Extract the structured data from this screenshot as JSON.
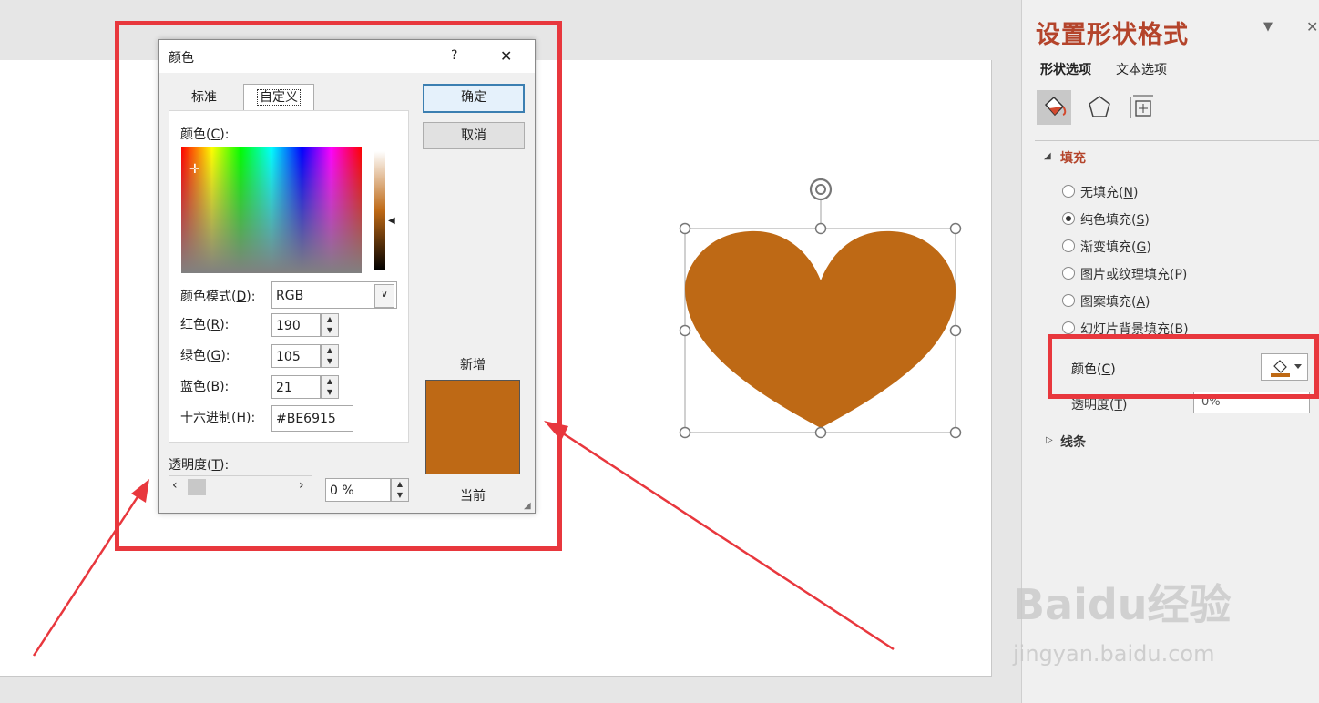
{
  "dialog": {
    "title": "颜色",
    "help": "?",
    "close": "✕",
    "tabs": [
      "标准",
      "自定义"
    ],
    "ok": "确定",
    "cancel": "取消",
    "color_label": "颜色(",
    "color_key": "C",
    "mode_label": "颜色模式(",
    "mode_key": "D",
    "mode_value": "RGB",
    "red_label": "红色(",
    "red_key": "R",
    "red_value": "190",
    "green_label": "绿色(",
    "green_key": "G",
    "green_value": "105",
    "blue_label": "蓝色(",
    "blue_key": "B",
    "blue_value": "21",
    "hex_label": "十六进制(",
    "hex_key": "H",
    "hex_value": "#BE6915",
    "transparency_label": "透明度(",
    "transparency_key": "T",
    "transparency_value": "0 %",
    "new_label": "新增",
    "current_label": "当前",
    "swatch_color": "#BE6915"
  },
  "pane": {
    "title": "设置形状格式",
    "tab_shape": "形状选项",
    "tab_text": "文本选项",
    "fill_header": "填充",
    "options": [
      {
        "label": "无填充(",
        "key": "N",
        "selected": false
      },
      {
        "label": "纯色填充(",
        "key": "S",
        "selected": true
      },
      {
        "label": "渐变填充(",
        "key": "G",
        "selected": false
      },
      {
        "label": "图片或纹理填充(",
        "key": "P",
        "selected": false
      },
      {
        "label": "图案填充(",
        "key": "A",
        "selected": false
      },
      {
        "label": "幻灯片背景填充(",
        "key": "B",
        "selected": false
      }
    ],
    "color_label": "颜色(",
    "color_key": "C",
    "transparency_label": "透明度(",
    "transparency_key": "T",
    "transparency_value": "0%",
    "line_header": "线条",
    "accent_color": "#b4442b"
  },
  "shape": {
    "fill_color": "#BE6915"
  },
  "watermark": {
    "brand": "Baidu经验",
    "url": "jingyan.baidu.com"
  }
}
